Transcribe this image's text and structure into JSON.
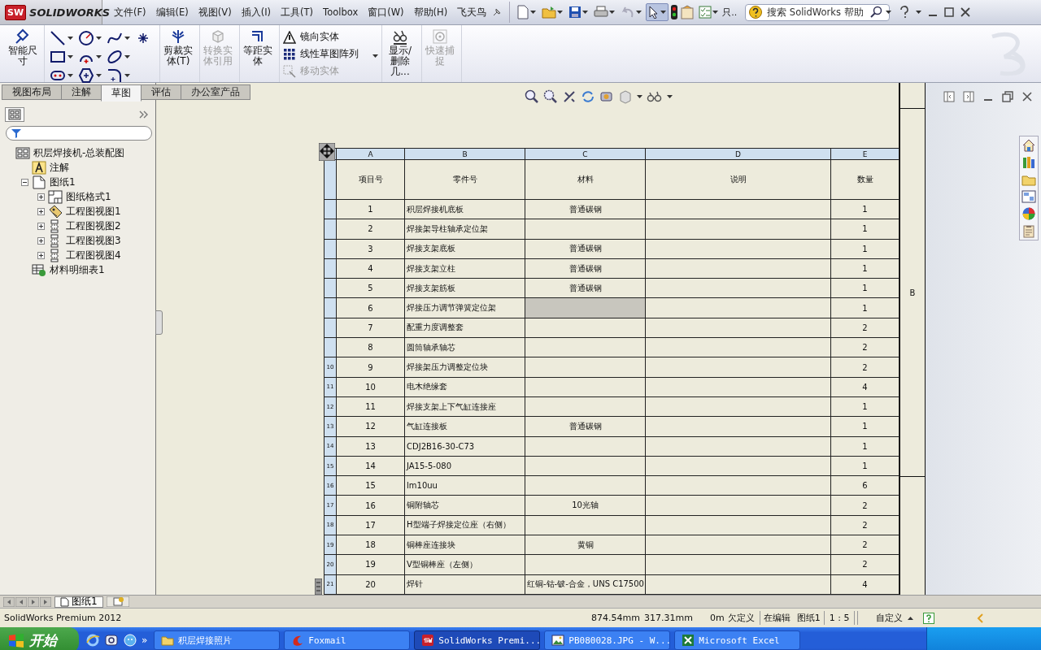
{
  "app": {
    "badge": "SW",
    "logo": "SOLIDWORKS"
  },
  "menu": [
    "文件(F)",
    "编辑(E)",
    "视图(V)",
    "插入(I)",
    "工具(T)",
    "Toolbox",
    "窗口(W)",
    "帮助(H)",
    "飞天鸟"
  ],
  "quick_toolbar": {
    "overflow": "只.."
  },
  "search": {
    "placeholder": "搜索 SolidWorks 帮助"
  },
  "ribbon": [
    {
      "kind": "large",
      "label": "智能尺寸",
      "disabled": false
    },
    {
      "kind": "tools"
    },
    {
      "kind": "large",
      "label": "剪裁实体(T)",
      "disabled": false
    },
    {
      "kind": "large",
      "label": "转换实体引用",
      "disabled": true
    },
    {
      "kind": "large",
      "label": "等距实体",
      "disabled": false
    },
    {
      "kind": "column",
      "items": [
        {
          "label": "镜向实体",
          "disabled": false
        },
        {
          "label": "线性草图阵列",
          "disabled": false
        },
        {
          "label": "移动实体",
          "disabled": true
        }
      ]
    },
    {
      "kind": "large",
      "label": "显示/删除几...",
      "disabled": false
    },
    {
      "kind": "large",
      "label": "快速捕捉",
      "disabled": true
    }
  ],
  "tabs": [
    {
      "label": "视图布局",
      "selected": false
    },
    {
      "label": "注解",
      "selected": false
    },
    {
      "label": "草图",
      "selected": true
    },
    {
      "label": "评估",
      "selected": false
    },
    {
      "label": "办公室产品",
      "selected": false
    }
  ],
  "tree": {
    "label": "积层焊接机-总装配图",
    "kind": "drawing",
    "children": [
      {
        "label": "注解",
        "kind": "note"
      },
      {
        "label": "图纸1",
        "kind": "sheet",
        "expanded": true,
        "children": [
          {
            "label": "图纸格式1",
            "kind": "format",
            "expanded": false
          },
          {
            "label": "工程图视图1",
            "kind": "model-view",
            "expanded": false
          },
          {
            "label": "工程图视图2",
            "kind": "view",
            "expanded": false
          },
          {
            "label": "工程图视图3",
            "kind": "view",
            "expanded": false
          },
          {
            "label": "工程图视图4",
            "kind": "view",
            "expanded": false
          }
        ]
      },
      {
        "label": "材料明细表1",
        "kind": "bom"
      }
    ]
  },
  "table": {
    "column_letters": [
      "A",
      "B",
      "C",
      "D",
      "E"
    ],
    "headers": [
      "项目号",
      "零件号",
      "材料",
      "说明",
      "数量"
    ],
    "rows": [
      {
        "item": "1",
        "part": "积层焊接机底板",
        "material": "普通碳钢",
        "qty": "1",
        "material_selected": false
      },
      {
        "item": "2",
        "part": "焊接架导柱轴承定位架",
        "qty": "1",
        "material_selected": false
      },
      {
        "item": "3",
        "part": "焊接支架底板",
        "material": "普通碳钢",
        "qty": "1",
        "material_selected": false
      },
      {
        "item": "4",
        "part": "焊接支架立柱",
        "material": "普通碳钢",
        "qty": "1",
        "material_selected": false
      },
      {
        "item": "5",
        "part": "焊接支架筋板",
        "material": "普通碳钢",
        "qty": "1",
        "material_selected": false
      },
      {
        "item": "6",
        "part": "焊接压力调节弹簧定位架",
        "qty": "1",
        "material_selected": true
      },
      {
        "item": "7",
        "part": "配重力度调整套",
        "qty": "2",
        "material_selected": false
      },
      {
        "item": "8",
        "part": "圆筒轴承轴芯",
        "qty": "2",
        "material_selected": false
      },
      {
        "row_number": "10",
        "item": "9",
        "part": "焊接架压力调整定位块",
        "qty": "2",
        "material_selected": false
      },
      {
        "row_number": "11",
        "item": "10",
        "part": "电木绝缘套",
        "qty": "4",
        "material_selected": false
      },
      {
        "row_number": "12",
        "item": "11",
        "part": "焊接支架上下气缸连接座",
        "qty": "1",
        "material_selected": false
      },
      {
        "row_number": "13",
        "item": "12",
        "part": "气缸连接板",
        "material": "普通碳钢",
        "qty": "1",
        "material_selected": false
      },
      {
        "row_number": "14",
        "item": "13",
        "part": "CDJ2B16-30-C73",
        "qty": "1",
        "material_selected": false
      },
      {
        "row_number": "15",
        "item": "14",
        "part": "JA15-5-080",
        "qty": "1",
        "material_selected": false
      },
      {
        "row_number": "16",
        "item": "15",
        "part": "lm10uu",
        "qty": "6",
        "material_selected": false
      },
      {
        "row_number": "17",
        "item": "16",
        "part": "铜附轴芯",
        "material": "10光轴",
        "qty": "2",
        "material_selected": false
      },
      {
        "row_number": "18",
        "item": "17",
        "part": "H型端子焊接定位座（右侧）",
        "qty": "2",
        "material_selected": false
      },
      {
        "row_number": "19",
        "item": "18",
        "part": "铜棒座连接块",
        "material": "黄铜",
        "qty": "2",
        "material_selected": false
      },
      {
        "row_number": "20",
        "item": "19",
        "part": "V型铜棒座（左侧）",
        "qty": "2",
        "material_selected": false
      },
      {
        "row_number": "21",
        "item": "20",
        "part": "焊针",
        "material": "红铜-钴-铍-合金，UNS C17500",
        "qty": "4",
        "material_selected": false
      }
    ]
  },
  "zone_label": "B",
  "sheet_tabs": [
    {
      "label": "图纸1",
      "selected": true
    }
  ],
  "status": {
    "product": "SolidWorks Premium 2012",
    "x": "874.54mm",
    "y": "317.31mm",
    "z": "0m",
    "state": "欠定义",
    "mode": "在编辑",
    "sheet": "图纸1",
    "scale": "1 : 5",
    "units": "自定义"
  },
  "taskbar": {
    "start": "开始",
    "more": "»",
    "tasks": [
      {
        "label": "积层焊接照片",
        "kind": "folder",
        "selected": false
      },
      {
        "label": "Foxmail",
        "kind": "mail",
        "selected": false
      },
      {
        "label": "SolidWorks Premi...",
        "kind": "cad",
        "selected": true
      },
      {
        "label": "PB080028.JPG - W...",
        "kind": "image",
        "selected": false
      },
      {
        "label": "Microsoft Excel",
        "kind": "spreadsheet",
        "selected": false
      }
    ]
  }
}
